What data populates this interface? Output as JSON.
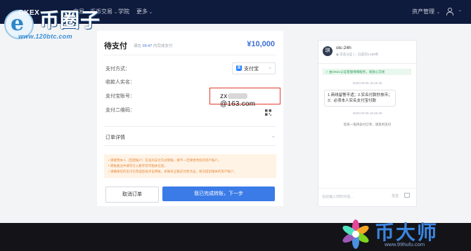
{
  "watermark_top": {
    "brand_text": "币圈子",
    "overlay_label": "OKEX",
    "url": "www.120btc.com"
  },
  "nav": {
    "items": [
      {
        "label": "交易",
        "has_chevron": false
      },
      {
        "label": "币币交易",
        "has_chevron": true
      },
      {
        "label": "学院",
        "has_chevron": false
      },
      {
        "label": "更多",
        "has_chevron": true
      }
    ],
    "asset_management": "资产管理",
    "icons": [
      "chevron-down-icon",
      "user-icon"
    ]
  },
  "order": {
    "title": "待支付",
    "countdown_prefix": "请在",
    "countdown_time": "09:47",
    "countdown_suffix": "内完成支付",
    "amount": "¥10,000",
    "payment_method_label": "支付方式：",
    "payment_method_value": "支付宝",
    "payee_name_label": "收款人实名：",
    "account_label": "支付宝账号：",
    "account_prefix": "zx",
    "account_suffix": "@163.com",
    "qrcode_label": "支付二维码：",
    "details_label": "订单详情",
    "notices": [
      "• 请使用本人（匹配账户）实名的支付方式转账，要不一定要更改您的资产账户。",
      "• 转账备注中请勿写入数字货币相关信息。",
      "• 请确保您的支付已完成后再点击转账，如果未全额支付而点击，将冻结您相关的资产账户。"
    ],
    "cancel_label": "取消订单",
    "confirm_label": "我已完成转账，下一步",
    "accent_color": "#3b7be8",
    "highlight_color": "#e23c2f"
  },
  "chat": {
    "avatar_letter": "琪",
    "name": "otc-24h",
    "sub_verified": "实名认证",
    "sub_stats": "已成交5,199单",
    "banner": "由OKEx认证客服保障服务，请放心交易",
    "time1": "2020-03-06 16:46:46",
    "message": "1.商线留警不适；2.实名付款秒放币；3：必须本人实名支付宝付款",
    "time2": "2020-03-06 16:46:48",
    "system_msg": "您有一笔待支付订单，请及时支付",
    "input_placeholder": "在此输入你的对话...",
    "send_label": "发送"
  },
  "watermark_bottom": {
    "brand_text": "币大师",
    "url": "www.99hufu.com"
  }
}
